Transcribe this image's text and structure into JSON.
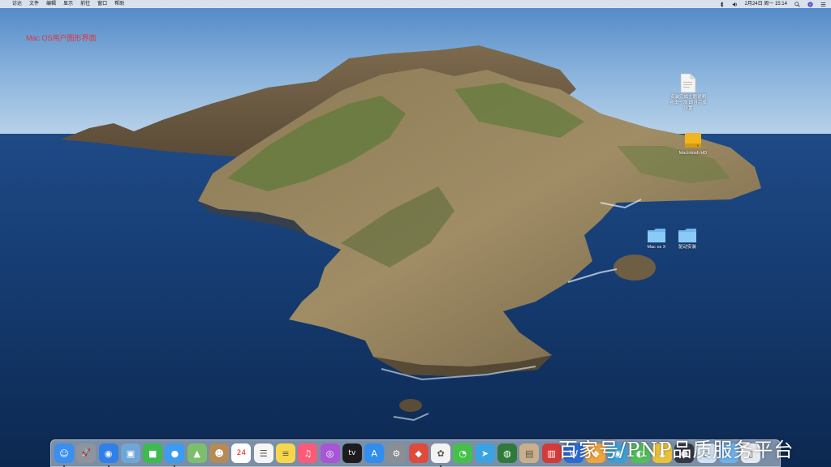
{
  "menubar": {
    "apple_glyph": "",
    "items": [
      "访达",
      "文件",
      "编辑",
      "显示",
      "前往",
      "窗口",
      "帮助"
    ],
    "datetime": "2月24日 周一 15:14"
  },
  "desktop": {
    "caption": "Mac OS用户图形界面",
    "icons": [
      {
        "label": "安装完成主题说明 点击一次 即可完成设置",
        "kind": "document-icon"
      },
      {
        "label": "Macintosh HD",
        "kind": "hard-drive-icon"
      },
      {
        "label": "Mac os X",
        "kind": "folder-icon"
      },
      {
        "label": "驱动安装",
        "kind": "folder-icon"
      }
    ]
  },
  "dock": {
    "apps": [
      {
        "name": "finder",
        "glyph": "☺",
        "color": "#3a8ff0"
      },
      {
        "name": "launchpad",
        "glyph": "🚀",
        "color": "#8d949e"
      },
      {
        "name": "safari",
        "glyph": "◉",
        "color": "#2f80e8"
      },
      {
        "name": "preview",
        "glyph": "▣",
        "color": "#6fa6d8"
      },
      {
        "name": "facetime",
        "glyph": "■",
        "color": "#3dbb4f"
      },
      {
        "name": "messages",
        "glyph": "●",
        "color": "#3b9cf2"
      },
      {
        "name": "maps",
        "glyph": "▲",
        "color": "#7cbf6a"
      },
      {
        "name": "contacts",
        "glyph": "☻",
        "color": "#b58a55"
      },
      {
        "name": "calendar",
        "glyph": "24",
        "color": "#ffffff"
      },
      {
        "name": "reminders",
        "glyph": "☰",
        "color": "#f5f5f5"
      },
      {
        "name": "notes",
        "glyph": "≡",
        "color": "#f7d64a"
      },
      {
        "name": "music",
        "glyph": "♫",
        "color": "#fa5c78"
      },
      {
        "name": "podcasts",
        "glyph": "◎",
        "color": "#a855d6"
      },
      {
        "name": "tv",
        "glyph": "tv",
        "color": "#1c1c1e"
      },
      {
        "name": "app-store",
        "glyph": "A",
        "color": "#2f8ef0"
      },
      {
        "name": "system-preferences",
        "glyph": "⚙",
        "color": "#8a8f96"
      },
      {
        "name": "app-red",
        "glyph": "◆",
        "color": "#e04a3a"
      },
      {
        "name": "photos",
        "glyph": "✿",
        "color": "#f2f2f2"
      },
      {
        "name": "wechat",
        "glyph": "◔",
        "color": "#45c14a"
      },
      {
        "name": "telegram",
        "glyph": "➤",
        "color": "#3aa3e3"
      },
      {
        "name": "globe-app",
        "glyph": "◍",
        "color": "#2f7a3a"
      },
      {
        "name": "archive-app",
        "glyph": "▤",
        "color": "#c9b08a"
      },
      {
        "name": "photo-booth",
        "glyph": "▥",
        "color": "#d33a3a"
      },
      {
        "name": "word",
        "glyph": "W",
        "color": "#2b6bd6"
      },
      {
        "name": "sketch-app",
        "glyph": "◆",
        "color": "#f2a33a"
      },
      {
        "name": "app-blue",
        "glyph": "◉",
        "color": "#3aa0d6"
      },
      {
        "name": "app-green",
        "glyph": "◐",
        "color": "#4fbf5a"
      },
      {
        "name": "app-yellow",
        "glyph": "▮",
        "color": "#e9c23a"
      },
      {
        "name": "app-dark",
        "glyph": "●",
        "color": "#333a44"
      },
      {
        "name": "app-light",
        "glyph": "◻",
        "color": "#d0e4f5"
      },
      {
        "name": "folder-downloads",
        "glyph": "↓",
        "color": "#6fb2ea"
      },
      {
        "name": "trash",
        "glyph": "▯",
        "color": "#e6e9ee"
      }
    ]
  },
  "watermark": "百家号/PNP品质服务平台"
}
